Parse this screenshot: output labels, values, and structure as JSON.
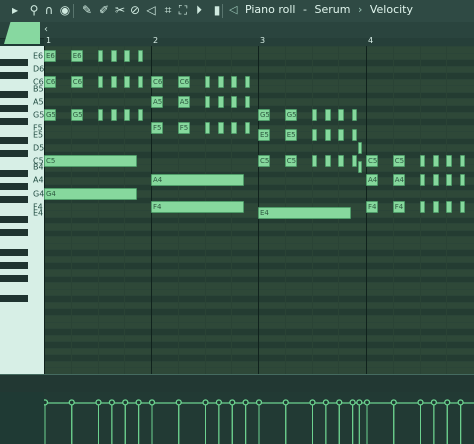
{
  "toolbar": {
    "icons": [
      {
        "name": "arrow-right-icon",
        "glyph": "▸"
      },
      {
        "name": "wrench-icon",
        "glyph": "⚲"
      },
      {
        "name": "magnet-icon",
        "glyph": "∩"
      },
      {
        "name": "snap-icon",
        "glyph": "◉"
      },
      {
        "name": "pencil-icon",
        "glyph": "✎"
      },
      {
        "name": "paint-brush-icon",
        "glyph": "✐"
      },
      {
        "name": "slice-icon",
        "glyph": "✂"
      },
      {
        "name": "mute-icon",
        "glyph": "⊘"
      },
      {
        "name": "speaker-icon",
        "glyph": "◁"
      },
      {
        "name": "select-icon",
        "glyph": "⌗"
      },
      {
        "name": "zoom-icon",
        "glyph": "⛶"
      },
      {
        "name": "playback-icon",
        "glyph": "⏵"
      },
      {
        "name": "level-icon",
        "glyph": "▮"
      }
    ],
    "title_speaker": "◁",
    "title_parts": [
      "Piano roll",
      "-",
      "Serum",
      "›",
      "Velocity"
    ]
  },
  "ruler": {
    "bars": [
      "1",
      "2",
      "3",
      "4"
    ]
  },
  "keyboard": {
    "labels": [
      "E6",
      "D6",
      "C6",
      "B5",
      "A5",
      "G5",
      "F5",
      "E5",
      "D5",
      "C5",
      "B4",
      "A4",
      "G4",
      "F4",
      "E4"
    ]
  },
  "notes": [
    {
      "p": "E6",
      "s": 0,
      "d": 0.5,
      "l": "E6"
    },
    {
      "p": "E6",
      "s": 1,
      "d": 0.5,
      "l": "E6"
    },
    {
      "p": "E6",
      "s": 2,
      "d": 0.25,
      "l": ""
    },
    {
      "p": "E6",
      "s": 2.5,
      "d": 0.25,
      "l": ""
    },
    {
      "p": "E6",
      "s": 3,
      "d": 0.25,
      "l": ""
    },
    {
      "p": "E6",
      "s": 3.5,
      "d": 0.25,
      "l": ""
    },
    {
      "p": "C6",
      "s": 0,
      "d": 0.5,
      "l": "C6"
    },
    {
      "p": "C6",
      "s": 1,
      "d": 0.5,
      "l": "C6"
    },
    {
      "p": "C6",
      "s": 2,
      "d": 0.25,
      "l": ""
    },
    {
      "p": "C6",
      "s": 2.5,
      "d": 0.25,
      "l": ""
    },
    {
      "p": "C6",
      "s": 3,
      "d": 0.25,
      "l": ""
    },
    {
      "p": "C6",
      "s": 3.5,
      "d": 0.25,
      "l": ""
    },
    {
      "p": "C6",
      "s": 4,
      "d": 0.5,
      "l": "C6"
    },
    {
      "p": "C6",
      "s": 5,
      "d": 0.5,
      "l": "C6"
    },
    {
      "p": "C6",
      "s": 6,
      "d": 0.25,
      "l": ""
    },
    {
      "p": "C6",
      "s": 6.5,
      "d": 0.25,
      "l": ""
    },
    {
      "p": "C6",
      "s": 7,
      "d": 0.25,
      "l": ""
    },
    {
      "p": "C6",
      "s": 7.5,
      "d": 0.25,
      "l": ""
    },
    {
      "p": "A5",
      "s": 4,
      "d": 0.5,
      "l": "A5"
    },
    {
      "p": "A5",
      "s": 5,
      "d": 0.5,
      "l": "A5"
    },
    {
      "p": "A5",
      "s": 6,
      "d": 0.25,
      "l": ""
    },
    {
      "p": "A5",
      "s": 6.5,
      "d": 0.25,
      "l": ""
    },
    {
      "p": "A5",
      "s": 7,
      "d": 0.25,
      "l": ""
    },
    {
      "p": "A5",
      "s": 7.5,
      "d": 0.25,
      "l": ""
    },
    {
      "p": "G5",
      "s": 0,
      "d": 0.5,
      "l": "G5"
    },
    {
      "p": "G5",
      "s": 1,
      "d": 0.5,
      "l": "G5"
    },
    {
      "p": "G5",
      "s": 2,
      "d": 0.25,
      "l": ""
    },
    {
      "p": "G5",
      "s": 2.5,
      "d": 0.25,
      "l": ""
    },
    {
      "p": "G5",
      "s": 3,
      "d": 0.25,
      "l": ""
    },
    {
      "p": "G5",
      "s": 3.5,
      "d": 0.25,
      "l": ""
    },
    {
      "p": "G5",
      "s": 8,
      "d": 0.5,
      "l": "G5"
    },
    {
      "p": "G5",
      "s": 9,
      "d": 0.5,
      "l": "G5"
    },
    {
      "p": "G5",
      "s": 10,
      "d": 0.25,
      "l": ""
    },
    {
      "p": "G5",
      "s": 10.5,
      "d": 0.25,
      "l": ""
    },
    {
      "p": "G5",
      "s": 11,
      "d": 0.25,
      "l": ""
    },
    {
      "p": "G5",
      "s": 11.5,
      "d": 0.25,
      "l": ""
    },
    {
      "p": "F5",
      "s": 4,
      "d": 0.5,
      "l": "F5"
    },
    {
      "p": "F5",
      "s": 5,
      "d": 0.5,
      "l": "F5"
    },
    {
      "p": "F5",
      "s": 6,
      "d": 0.25,
      "l": ""
    },
    {
      "p": "F5",
      "s": 6.5,
      "d": 0.25,
      "l": ""
    },
    {
      "p": "F5",
      "s": 7,
      "d": 0.25,
      "l": ""
    },
    {
      "p": "F5",
      "s": 7.5,
      "d": 0.25,
      "l": ""
    },
    {
      "p": "E5",
      "s": 8,
      "d": 0.5,
      "l": "E5"
    },
    {
      "p": "E5",
      "s": 9,
      "d": 0.5,
      "l": "E5"
    },
    {
      "p": "E5",
      "s": 10,
      "d": 0.25,
      "l": ""
    },
    {
      "p": "E5",
      "s": 10.5,
      "d": 0.25,
      "l": ""
    },
    {
      "p": "E5",
      "s": 11,
      "d": 0.25,
      "l": ""
    },
    {
      "p": "E5",
      "s": 11.5,
      "d": 0.25,
      "l": ""
    },
    {
      "p": "D5",
      "s": 11.75,
      "d": 0.15,
      "l": ""
    },
    {
      "p": "C5",
      "s": 0,
      "d": 3.5,
      "l": "C5"
    },
    {
      "p": "C5",
      "s": 8,
      "d": 0.5,
      "l": "C5"
    },
    {
      "p": "C5",
      "s": 9,
      "d": 0.5,
      "l": "C5"
    },
    {
      "p": "C5",
      "s": 10,
      "d": 0.25,
      "l": ""
    },
    {
      "p": "C5",
      "s": 10.5,
      "d": 0.25,
      "l": ""
    },
    {
      "p": "C5",
      "s": 11,
      "d": 0.25,
      "l": ""
    },
    {
      "p": "C5",
      "s": 11.5,
      "d": 0.25,
      "l": ""
    },
    {
      "p": "C5",
      "s": 12,
      "d": 0.5,
      "l": "C5"
    },
    {
      "p": "C5",
      "s": 13,
      "d": 0.5,
      "l": "C5"
    },
    {
      "p": "C5",
      "s": 14,
      "d": 0.25,
      "l": ""
    },
    {
      "p": "C5",
      "s": 14.5,
      "d": 0.25,
      "l": ""
    },
    {
      "p": "C5",
      "s": 15,
      "d": 0.25,
      "l": ""
    },
    {
      "p": "C5",
      "s": 15.5,
      "d": 0.25,
      "l": ""
    },
    {
      "p": "B4",
      "s": 11.75,
      "d": 0.15,
      "l": ""
    },
    {
      "p": "A4",
      "s": 4,
      "d": 3.5,
      "l": "A4"
    },
    {
      "p": "A4",
      "s": 12,
      "d": 0.5,
      "l": "A4"
    },
    {
      "p": "A4",
      "s": 13,
      "d": 0.5,
      "l": "A4"
    },
    {
      "p": "A4",
      "s": 14,
      "d": 0.25,
      "l": ""
    },
    {
      "p": "A4",
      "s": 14.5,
      "d": 0.25,
      "l": ""
    },
    {
      "p": "A4",
      "s": 15,
      "d": 0.25,
      "l": ""
    },
    {
      "p": "A4",
      "s": 15.5,
      "d": 0.25,
      "l": ""
    },
    {
      "p": "G4",
      "s": 0,
      "d": 3.5,
      "l": "G4"
    },
    {
      "p": "F4",
      "s": 4,
      "d": 3.5,
      "l": "F4"
    },
    {
      "p": "F4",
      "s": 12,
      "d": 0.5,
      "l": "F4"
    },
    {
      "p": "F4",
      "s": 13,
      "d": 0.5,
      "l": "F4"
    },
    {
      "p": "F4",
      "s": 14,
      "d": 0.25,
      "l": ""
    },
    {
      "p": "F4",
      "s": 14.5,
      "d": 0.25,
      "l": ""
    },
    {
      "p": "F4",
      "s": 15,
      "d": 0.25,
      "l": ""
    },
    {
      "p": "F4",
      "s": 15.5,
      "d": 0.25,
      "l": ""
    },
    {
      "p": "E4",
      "s": 8,
      "d": 3.5,
      "l": "E4"
    }
  ],
  "velocity": {
    "level": 0.8,
    "count": 40
  },
  "colors": {
    "note": "#86d89d",
    "accent": "#6cd28f"
  }
}
